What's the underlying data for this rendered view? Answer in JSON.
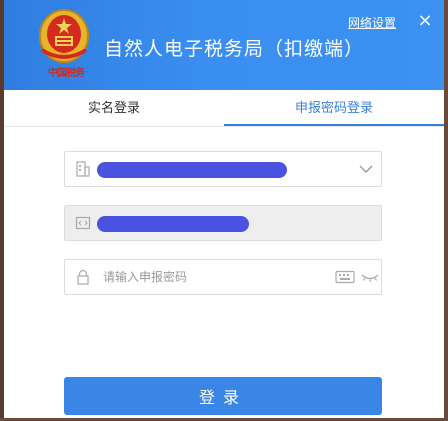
{
  "header": {
    "title": "自然人电子税务局（扣缴端）",
    "emblem_text": "中国税务",
    "net_settings_label": "网络设置",
    "close_glyph": "×"
  },
  "tabs": [
    {
      "label": "实名登录",
      "active": false
    },
    {
      "label": "申报密码登录",
      "active": true
    }
  ],
  "form": {
    "account_value": "",
    "id_value": "",
    "password_placeholder": "请输入申报密码"
  },
  "login_button_label": "登录",
  "colors": {
    "header_blue": "#3a8ef0",
    "accent": "#3a7fd8",
    "redaction": "#4a52e0",
    "emblem_red": "#d42a1e"
  }
}
